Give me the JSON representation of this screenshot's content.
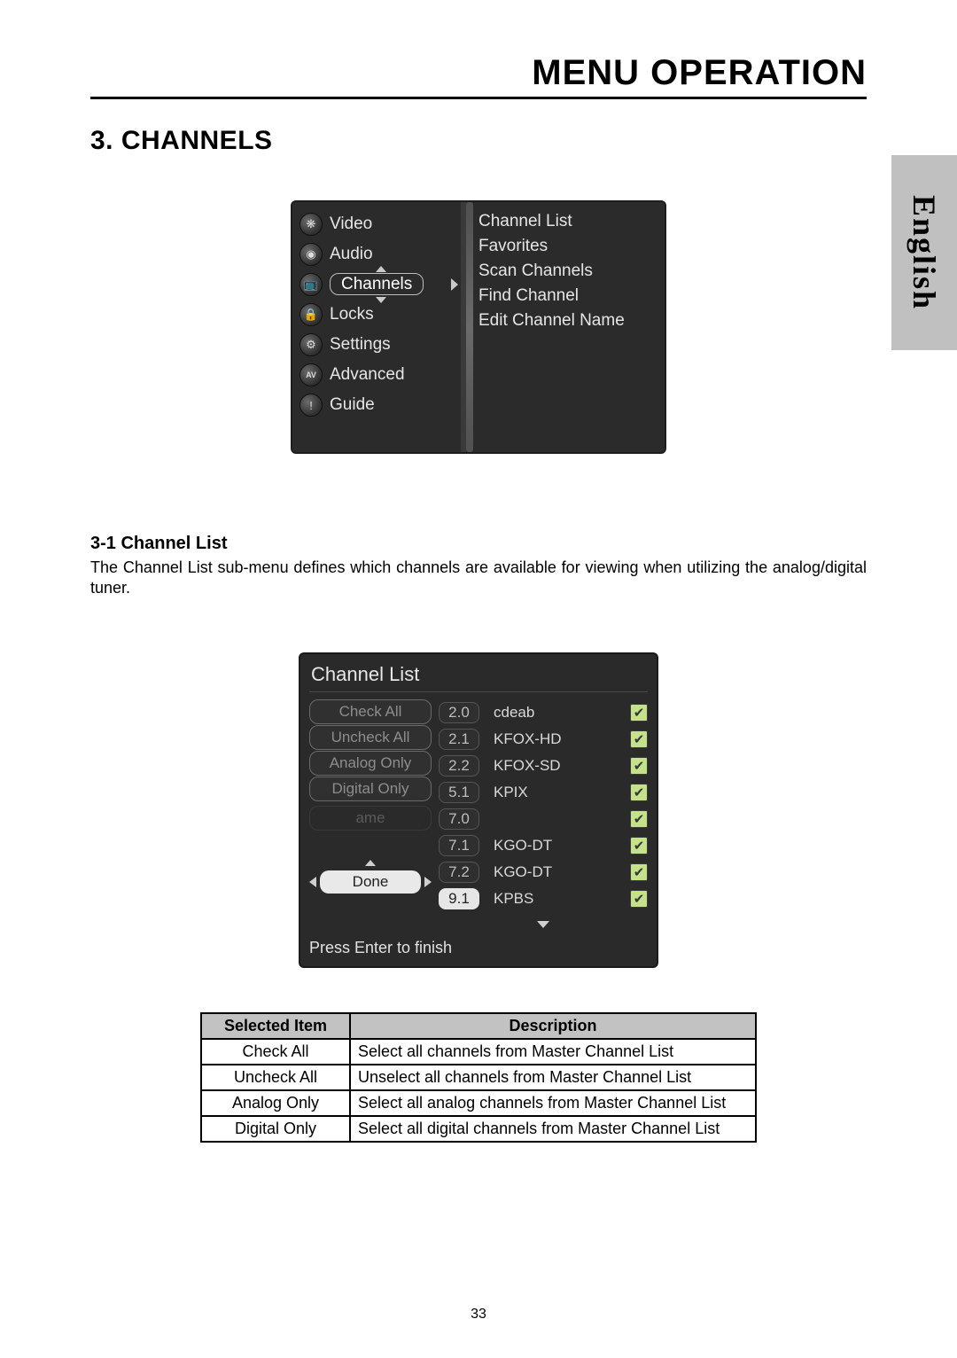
{
  "header": {
    "title": "MENU OPERATION"
  },
  "section": {
    "title": "3. CHANNELS"
  },
  "lang_tab": "English",
  "menu": {
    "items": [
      {
        "label": "Video",
        "glyph": "❋"
      },
      {
        "label": "Audio",
        "glyph": "◉"
      },
      {
        "label": "Channels",
        "glyph": "📺",
        "selected": true
      },
      {
        "label": "Locks",
        "glyph": "🔒"
      },
      {
        "label": "Settings",
        "glyph": "⚙"
      },
      {
        "label": "Advanced",
        "glyph": "AV"
      },
      {
        "label": "Guide",
        "glyph": "!"
      }
    ],
    "submenu": [
      "Channel List",
      "Favorites",
      "Scan Channels",
      "Find Channel",
      "Edit Channel Name"
    ]
  },
  "sub": {
    "title": "3-1  Channel List",
    "para": "The Channel List sub-menu defines which channels are available for viewing when utilizing the analog/digital tuner."
  },
  "chlist": {
    "title": "Channel List",
    "buttons": [
      "Check All",
      "Uncheck All",
      "Analog Only",
      "Digital Only"
    ],
    "ghost": "ame",
    "done": "Done",
    "hint": "Press Enter to finish",
    "rows": [
      {
        "num": "2.0",
        "name": "cdeab",
        "checked": true
      },
      {
        "num": "2.1",
        "name": "KFOX-HD",
        "checked": true
      },
      {
        "num": "2.2",
        "name": "KFOX-SD",
        "checked": true
      },
      {
        "num": "5.1",
        "name": "KPIX",
        "checked": true
      },
      {
        "num": "7.0",
        "name": "",
        "checked": true
      },
      {
        "num": "7.1",
        "name": "KGO-DT",
        "checked": true
      },
      {
        "num": "7.2",
        "name": "KGO-DT",
        "checked": true
      },
      {
        "num": "9.1",
        "name": "KPBS",
        "checked": true,
        "active": true
      }
    ]
  },
  "desc_table": {
    "headers": [
      "Selected Item",
      "Description"
    ],
    "rows": [
      {
        "item": "Check All",
        "desc": "Select all channels from Master Channel List"
      },
      {
        "item": "Uncheck All",
        "desc": "Unselect all channels from Master Channel List"
      },
      {
        "item": "Analog Only",
        "desc": "Select all analog channels from Master Channel List"
      },
      {
        "item": "Digital Only",
        "desc": "Select all digital channels from Master Channel List"
      }
    ]
  },
  "page_number": "33"
}
